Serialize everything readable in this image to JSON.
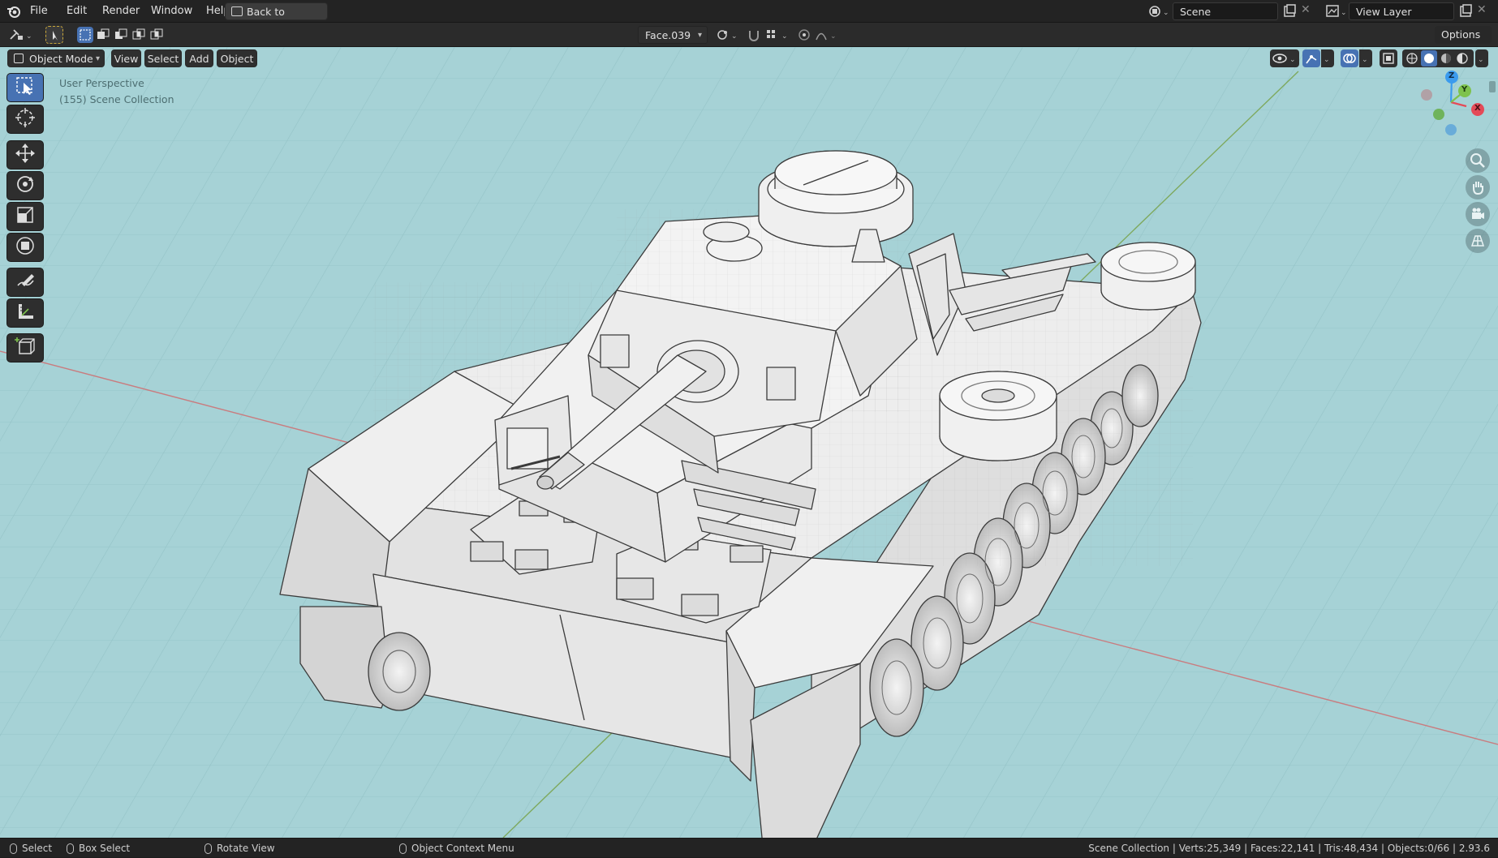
{
  "menu": {
    "items": [
      "File",
      "Edit",
      "Render",
      "Window",
      "Help"
    ],
    "back_button": "Back to Previous"
  },
  "scene": {
    "label": "Scene"
  },
  "view_layer": {
    "label": "View Layer"
  },
  "tool_header": {
    "active_face": "Face.039",
    "options_label": "Options"
  },
  "viewport_header": {
    "mode": "Object Mode",
    "menus": [
      "View",
      "Select",
      "Add",
      "Object"
    ]
  },
  "viewport": {
    "perspective": "User Perspective",
    "collection": "(155) Scene Collection"
  },
  "gizmo": {
    "x": "X",
    "y": "Y",
    "z": "Z"
  },
  "statusbar": {
    "select": "Select",
    "box_select": "Box Select",
    "rotate_view": "Rotate View",
    "context_menu": "Object Context Menu",
    "stats": "Scene Collection | Verts:25,349 | Faces:22,141 | Tris:48,434 | Objects:0/66 | 2.93.6"
  },
  "colors": {
    "viewport_bg": "#a6d2d6",
    "accent": "#4772b3",
    "x_axis": "#e44a57",
    "y_axis": "#7ec24d",
    "z_axis": "#3b9bee"
  },
  "icons": {
    "toolbar": [
      "select-box-icon",
      "cursor-icon",
      "move-icon",
      "rotate-icon",
      "scale-icon",
      "transform-icon",
      "annotate-icon",
      "measure-icon",
      "add-cube-icon"
    ],
    "navigation": [
      "zoom-icon",
      "pan-hand-icon",
      "camera-icon",
      "grid-ortho-icon"
    ]
  }
}
